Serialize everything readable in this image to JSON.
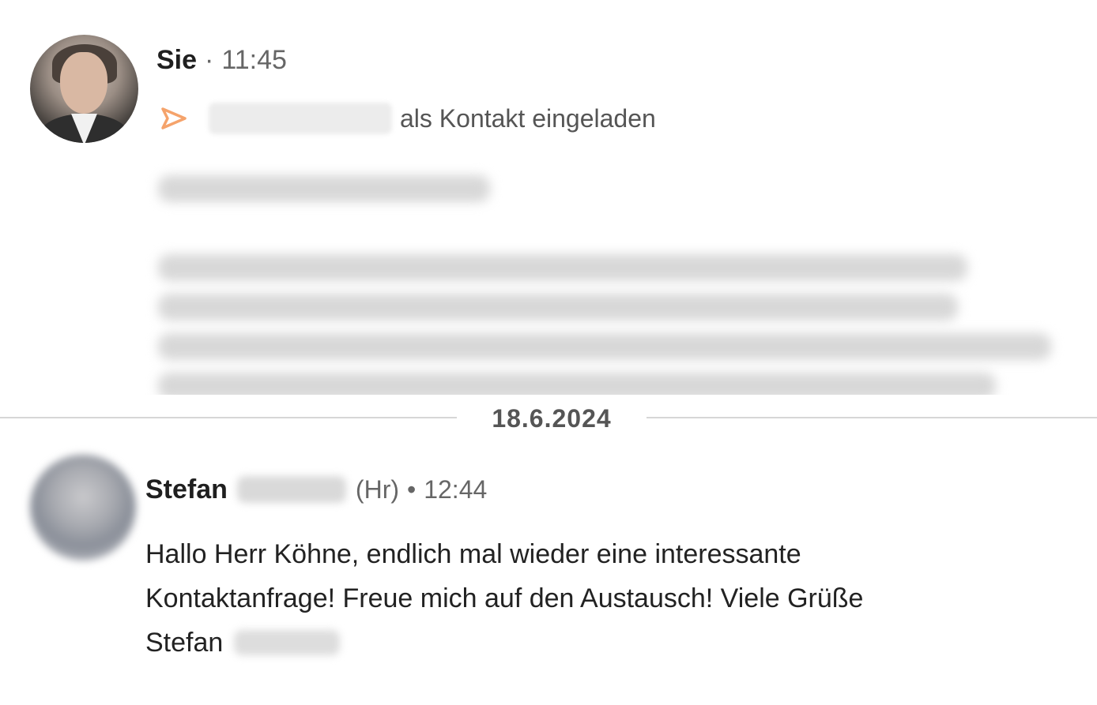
{
  "first_message": {
    "sender": "Sie",
    "separator": "·",
    "time": "11:45",
    "invite_icon": "send-icon",
    "invite_text": "als Kontakt eingeladen",
    "accent_color": "#f5a36b"
  },
  "divider": {
    "date": "18.6.2024"
  },
  "second_message": {
    "sender_first_name": "Stefan",
    "sender_suffix": "(Hr)",
    "bullet": "•",
    "time": "12:44",
    "lines": [
      "Hallo Herr Köhne, endlich mal wieder eine interessante",
      "Kontaktanfrage! Freue mich auf den Austausch! Viele Grüße",
      "Stefan"
    ]
  }
}
